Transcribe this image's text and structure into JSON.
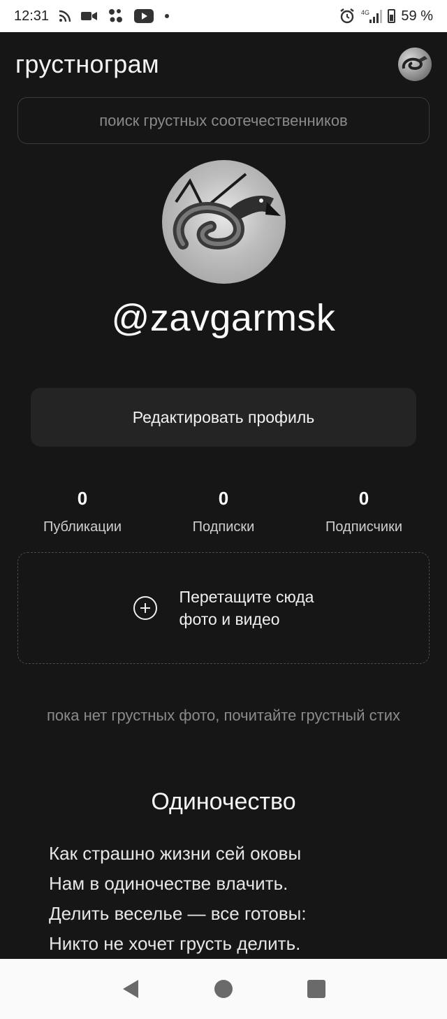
{
  "status_bar": {
    "time": "12:31",
    "battery": "59 %",
    "network": "4G"
  },
  "header": {
    "title": "грустнограм"
  },
  "search": {
    "placeholder": "поиск грустных соотечественников"
  },
  "profile": {
    "username": "@zavgarmsk",
    "edit_label": "Редактировать профиль"
  },
  "stats": [
    {
      "value": "0",
      "label": "Публикации"
    },
    {
      "value": "0",
      "label": "Подписки"
    },
    {
      "value": "0",
      "label": "Подписчики"
    }
  ],
  "upload": {
    "text": "Перетащите сюда\nфото и видео"
  },
  "empty_note": "пока нет грустных фото, почитайте грустный стих",
  "poem": {
    "title": "Одиночество",
    "lines": [
      "Как страшно жизни сей оковы",
      "Нам в одиночестве влачить.",
      "Делить веселье — все готовы:",
      "Никто не хочет грусть делить."
    ]
  },
  "icons": {
    "status": [
      "rss-icon",
      "video-camera-icon",
      "app-dots-icon",
      "youtube-icon",
      "notification-dot-icon",
      "alarm-icon",
      "signal-icon",
      "battery-icon"
    ],
    "nav": [
      "back-icon",
      "home-icon",
      "recents-icon"
    ]
  }
}
